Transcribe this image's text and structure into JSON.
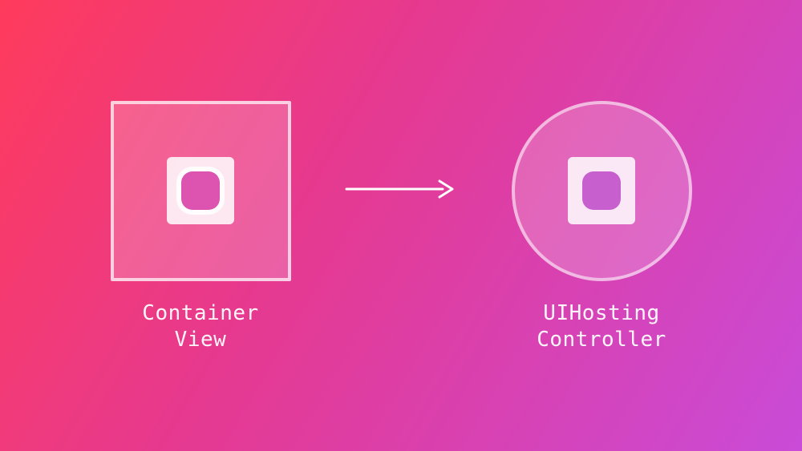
{
  "left": {
    "label": "Container\nView"
  },
  "right": {
    "label": "UIHosting\nController"
  }
}
